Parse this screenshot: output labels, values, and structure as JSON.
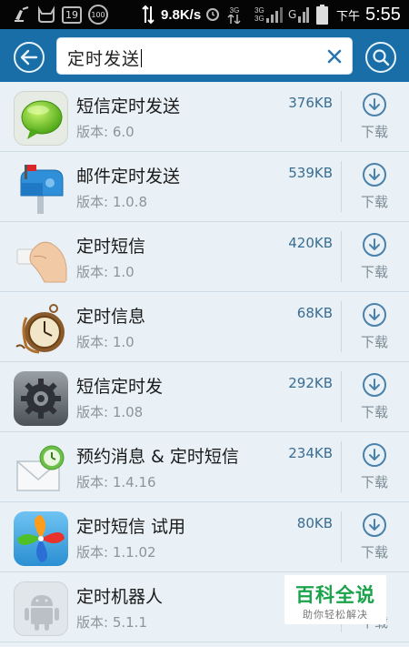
{
  "status_bar": {
    "notif_box_1": "19",
    "notif_circle": "100",
    "net_speed": "9.8K/s",
    "sig_3g_1": "3G",
    "sig_3g_2": "3G",
    "sig_3g_3": "3G",
    "sig_g": "G",
    "ampm": "下午",
    "time": "5:55"
  },
  "search": {
    "query": "定时发送"
  },
  "apps": [
    {
      "name": "短信定时发送",
      "version": "版本: 6.0",
      "size": "376KB",
      "download_label": "下载",
      "icon": "sms-bubble-icon"
    },
    {
      "name": "邮件定时发送",
      "version": "版本: 1.0.8",
      "size": "539KB",
      "download_label": "下载",
      "icon": "mailbox-icon"
    },
    {
      "name": "定时短信",
      "version": "版本: 1.0",
      "size": "420KB",
      "download_label": "下载",
      "icon": "hand-holding-card-icon"
    },
    {
      "name": "定时信息",
      "version": "版本: 1.0",
      "size": "68KB",
      "download_label": "下载",
      "icon": "pocket-watch-icon"
    },
    {
      "name": "短信定时发",
      "version": "版本: 1.08",
      "size": "292KB",
      "download_label": "下载",
      "icon": "gear-settings-icon"
    },
    {
      "name": "预约消息 & 定时短信",
      "version": "版本: 1.4.16",
      "size": "234KB",
      "download_label": "下载",
      "icon": "envelope-clock-icon"
    },
    {
      "name": "定时短信 试用",
      "version": "版本: 1.1.02",
      "size": "80KB",
      "download_label": "下载",
      "icon": "pinwheel-icon"
    },
    {
      "name": "定时机器人",
      "version": "版本: 5.1.1",
      "size": "",
      "download_label": "下载",
      "icon": "android-robot-icon"
    }
  ],
  "watermark": {
    "title": "百科全说",
    "subtitle": "助你轻松解决"
  },
  "colors": {
    "header": "#1a6ea8",
    "list_bg": "#e9f1f6",
    "accent": "#4a81ab"
  }
}
